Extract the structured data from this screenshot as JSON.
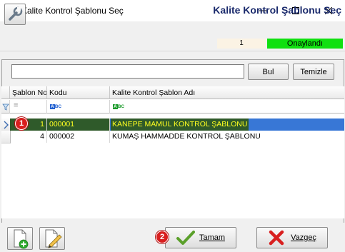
{
  "window": {
    "title": "Kalite Kontrol Şablonu Seç",
    "minimize": "—",
    "maximize": "☐",
    "close": "✕"
  },
  "header": {
    "form_title": "Kalite Kontrol Şablonu Seç",
    "record_no": "1",
    "status": "Onaylandı"
  },
  "search": {
    "value": "",
    "find_label": "Bul",
    "clear_label": "Temizle"
  },
  "grid": {
    "columns": [
      "Şablon No",
      "Kodu",
      "Kalite Kontrol Şablon Adı"
    ],
    "filter": {
      "operator": "=",
      "kod_type": "ABC",
      "ad_type": "ABC"
    },
    "rows": [
      {
        "no": "1",
        "kod": "000001",
        "ad": "KANEPE MAMUL KONTROL ŞABLONU"
      },
      {
        "no": "4",
        "kod": "000002",
        "ad": "KUMAŞ HAMMADDE KONTROL ŞABLONU"
      }
    ]
  },
  "annotations": [
    "1",
    "2"
  ],
  "footer": {
    "ok_label": "Tamam",
    "cancel_label": "Vazgeç"
  },
  "icons": {
    "app": "butterfly-icon",
    "tool": "wrench-icon",
    "filter": "funnel-icon",
    "row_indicator": "chevron-right-icon",
    "new": "new-document-icon",
    "edit": "edit-document-icon",
    "ok": "checkmark-icon",
    "cancel": "cross-icon"
  },
  "colors": {
    "selected_row": "#3877d6",
    "selected_text": "#ffff20",
    "status_bg": "#10e010",
    "title": "#1a2a6c"
  }
}
